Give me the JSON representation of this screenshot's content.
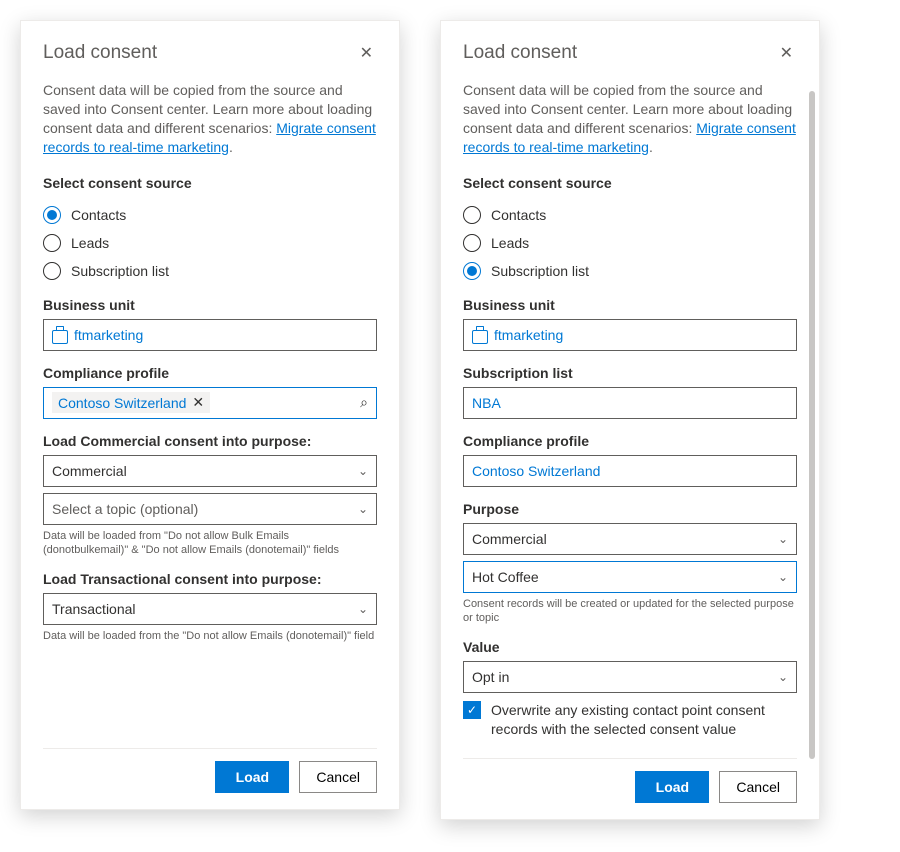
{
  "left": {
    "title": "Load consent",
    "intro_prefix": "Consent data will be copied from the source and saved into Consent center. Learn more about loading consent data and different scenarios: ",
    "intro_link": "Migrate consent records to real-time marketing",
    "intro_suffix": ".",
    "select_source_label": "Select consent source",
    "sources": {
      "contacts": "Contacts",
      "leads": "Leads",
      "subscription": "Subscription list"
    },
    "selected_source": "contacts",
    "bu_label": "Business unit",
    "bu_value": "ftmarketing",
    "compliance_label": "Compliance profile",
    "compliance_value": "Contoso Switzerland",
    "commercial_heading": "Load Commercial consent into purpose:",
    "commercial_value": "Commercial",
    "commercial_topic_placeholder": "Select a topic (optional)",
    "commercial_helper": "Data will be loaded from \"Do not allow Bulk Emails (donotbulkemail)\" & \"Do not allow Emails (donotemail)\" fields",
    "transactional_heading": "Load Transactional consent into purpose:",
    "transactional_value": "Transactional",
    "transactional_helper": "Data will be loaded from the \"Do not allow Emails (donotemail)\" field",
    "load_btn": "Load",
    "cancel_btn": "Cancel"
  },
  "right": {
    "title": "Load consent",
    "intro_prefix": "Consent data will be copied from the source and saved into Consent center. Learn more about loading consent data and different scenarios: ",
    "intro_link": "Migrate consent records to real-time marketing",
    "intro_suffix": ".",
    "select_source_label": "Select consent source",
    "sources": {
      "contacts": "Contacts",
      "leads": "Leads",
      "subscription": "Subscription list"
    },
    "selected_source": "subscription",
    "bu_label": "Business unit",
    "bu_value": "ftmarketing",
    "sub_list_label": "Subscription list",
    "sub_list_value": "NBA",
    "compliance_label": "Compliance profile",
    "compliance_value": "Contoso Switzerland",
    "purpose_label": "Purpose",
    "purpose_value": "Commercial",
    "purpose_topic_value": "Hot Coffee",
    "purpose_helper": "Consent records will be created or updated for the selected purpose or topic",
    "value_label": "Value",
    "value_value": "Opt in",
    "overwrite_label": "Overwrite any existing contact point consent records with the selected consent value",
    "load_btn": "Load",
    "cancel_btn": "Cancel"
  }
}
